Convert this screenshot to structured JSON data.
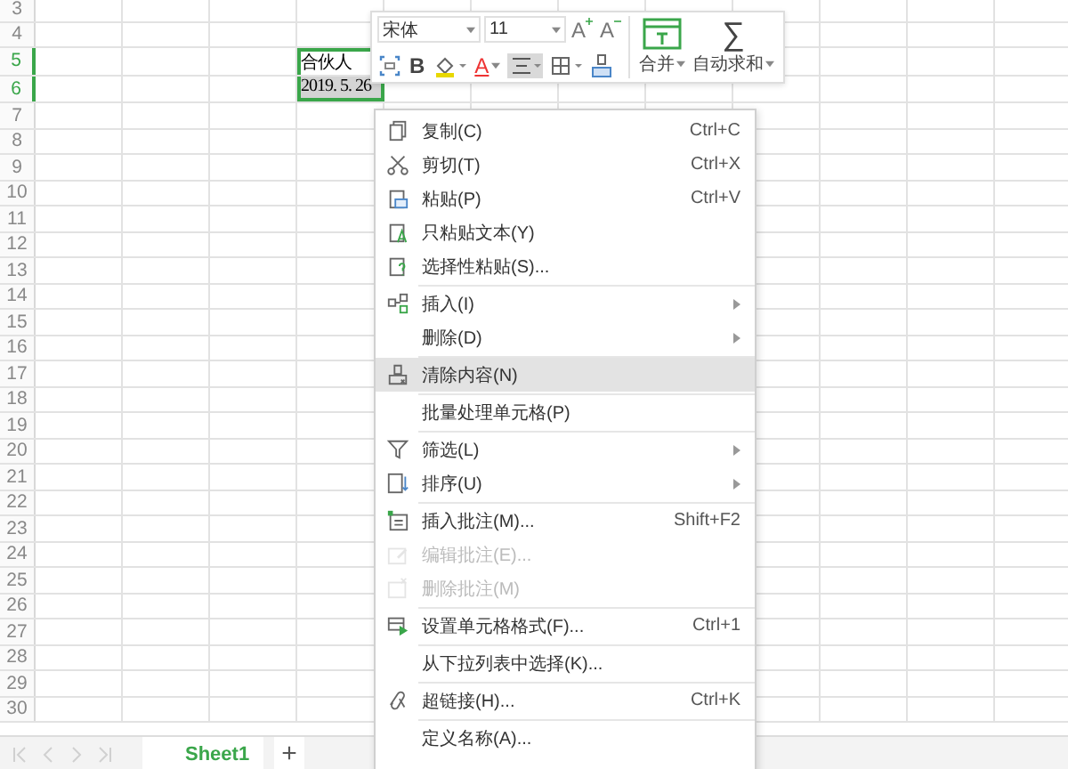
{
  "grid": {
    "rows": [
      {
        "number": "3",
        "selected": false
      },
      {
        "number": "4",
        "selected": false
      },
      {
        "number": "5",
        "selected": true,
        "cell": {
          "text": "合伙人",
          "active": true
        }
      },
      {
        "number": "6",
        "selected": true,
        "cell": {
          "text": "2019. 5. 26",
          "active": false
        }
      },
      {
        "number": "7",
        "selected": false
      },
      {
        "number": "8",
        "selected": false
      },
      {
        "number": "9",
        "selected": false
      },
      {
        "number": "10",
        "selected": false
      },
      {
        "number": "11",
        "selected": false
      },
      {
        "number": "12",
        "selected": false
      },
      {
        "number": "13",
        "selected": false
      },
      {
        "number": "14",
        "selected": false
      },
      {
        "number": "15",
        "selected": false
      },
      {
        "number": "16",
        "selected": false
      },
      {
        "number": "17",
        "selected": false
      },
      {
        "number": "18",
        "selected": false
      },
      {
        "number": "19",
        "selected": false
      },
      {
        "number": "20",
        "selected": false
      },
      {
        "number": "21",
        "selected": false
      },
      {
        "number": "22",
        "selected": false
      },
      {
        "number": "23",
        "selected": false
      },
      {
        "number": "24",
        "selected": false
      },
      {
        "number": "25",
        "selected": false
      },
      {
        "number": "26",
        "selected": false
      },
      {
        "number": "27",
        "selected": false
      },
      {
        "number": "28",
        "selected": false
      },
      {
        "number": "29",
        "selected": false
      },
      {
        "number": "30",
        "selected": false
      }
    ]
  },
  "mini_toolbar": {
    "font_name": "宋体",
    "font_size": "11",
    "grow_font": "A",
    "shrink_font": "A",
    "bold": "B",
    "font_color": "A",
    "align_pressed": true,
    "merge": "合并",
    "sum_symbol": "∑",
    "autosum": "自动求和"
  },
  "context_menu": {
    "groups": [
      [
        {
          "label": "复制(C)",
          "shortcut": "Ctrl+C",
          "submenu": false,
          "disabled": false,
          "selected": false
        },
        {
          "label": "剪切(T)",
          "shortcut": "Ctrl+X",
          "submenu": false,
          "disabled": false,
          "selected": false
        },
        {
          "label": "粘贴(P)",
          "shortcut": "Ctrl+V",
          "submenu": false,
          "disabled": false,
          "selected": false
        },
        {
          "label": "只粘贴文本(Y)",
          "submenu": false,
          "disabled": false,
          "selected": false
        },
        {
          "label": "选择性粘贴(S)...",
          "submenu": false,
          "disabled": false,
          "selected": false
        }
      ],
      [
        {
          "label": "插入(I)",
          "submenu": true,
          "disabled": false,
          "selected": false
        },
        {
          "label": "删除(D)",
          "submenu": true,
          "disabled": false,
          "selected": false
        }
      ],
      [
        {
          "label": "清除内容(N)",
          "submenu": false,
          "disabled": false,
          "selected": true
        }
      ],
      [
        {
          "label": "批量处理单元格(P)",
          "submenu": false,
          "disabled": false,
          "selected": false
        }
      ],
      [
        {
          "label": "筛选(L)",
          "submenu": true,
          "disabled": false,
          "selected": false
        },
        {
          "label": "排序(U)",
          "submenu": true,
          "disabled": false,
          "selected": false
        }
      ],
      [
        {
          "label": "插入批注(M)...",
          "shortcut": "Shift+F2",
          "submenu": false,
          "disabled": false,
          "selected": false
        },
        {
          "label": "编辑批注(E)...",
          "submenu": false,
          "disabled": true,
          "selected": false
        },
        {
          "label": "删除批注(M)",
          "submenu": false,
          "disabled": true,
          "selected": false
        }
      ],
      [
        {
          "label": "设置单元格格式(F)...",
          "shortcut": "Ctrl+1",
          "submenu": false,
          "disabled": false,
          "selected": false
        }
      ],
      [
        {
          "label": "从下拉列表中选择(K)...",
          "submenu": false,
          "disabled": false,
          "selected": false
        }
      ],
      [
        {
          "label": "超链接(H)...",
          "shortcut": "Ctrl+K",
          "submenu": false,
          "disabled": false,
          "selected": false
        }
      ],
      [
        {
          "label": "定义名称(A)...",
          "submenu": false,
          "disabled": false,
          "selected": false
        }
      ]
    ]
  },
  "sheet_tabs": [
    {
      "label": "Sheet1",
      "selected": true
    }
  ],
  "add_sheet": "+"
}
